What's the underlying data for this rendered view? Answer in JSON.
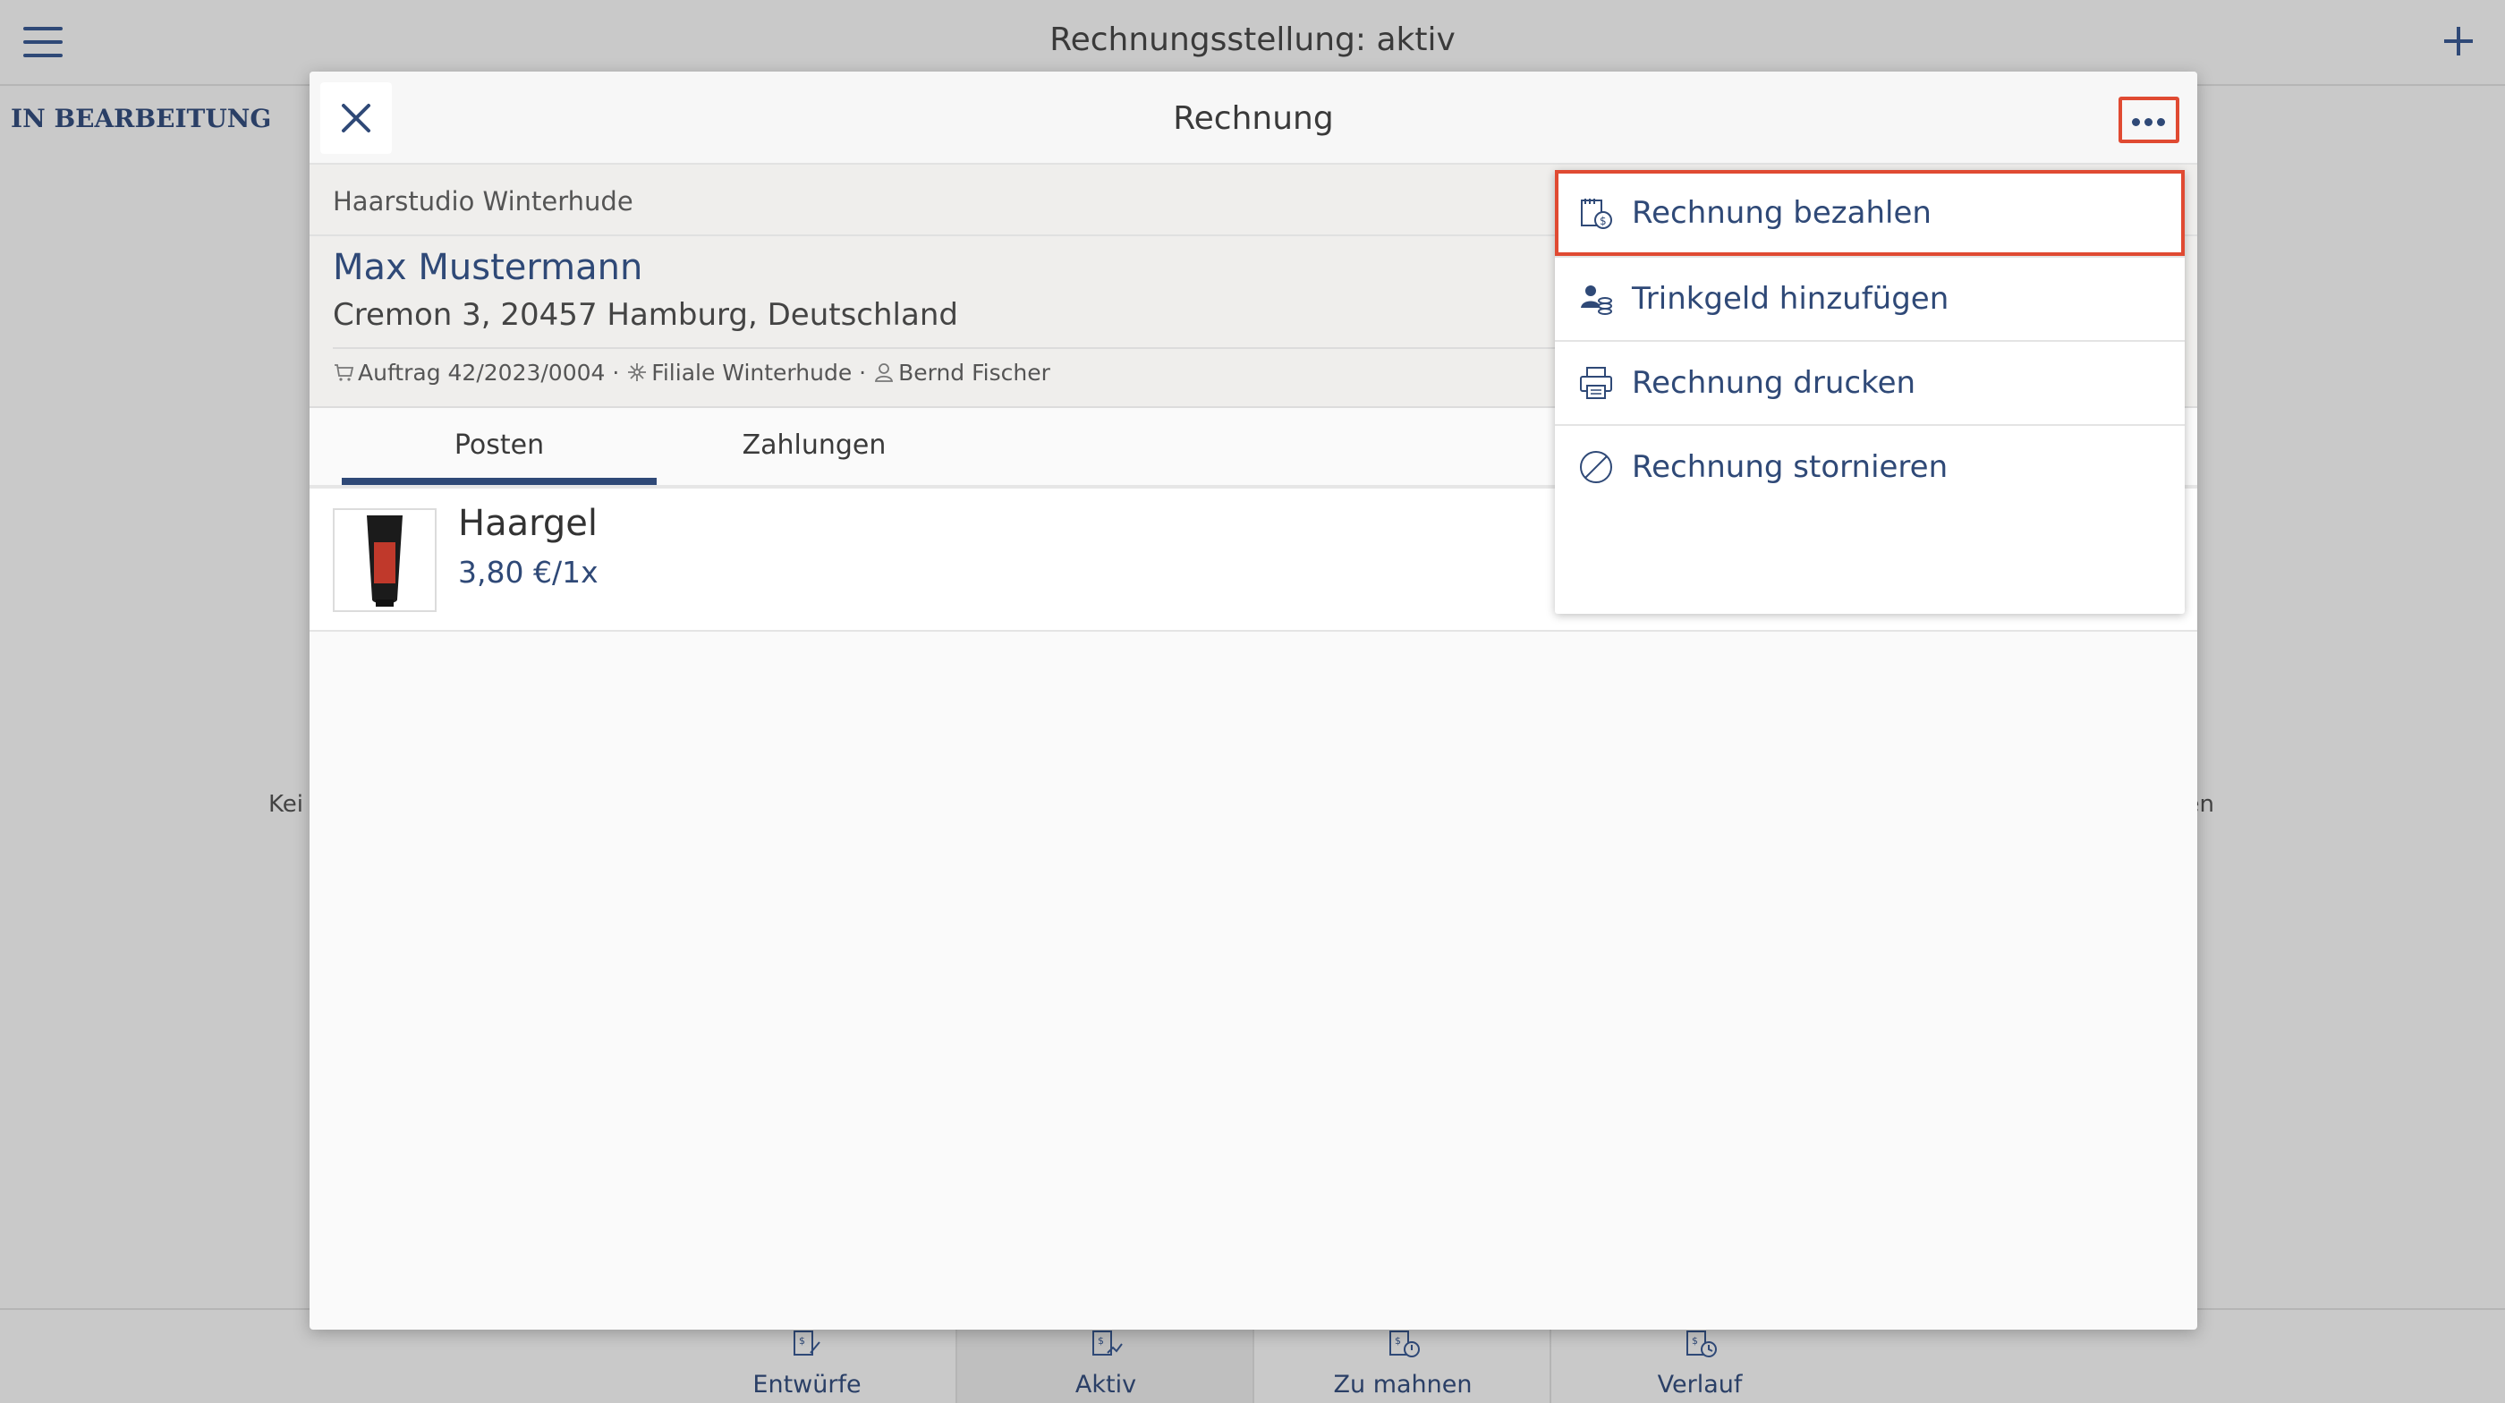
{
  "app": {
    "title": "Rechnungsstellung: aktiv",
    "section_label": "IN BEARBEITUNG",
    "empty_left": "Kei",
    "empty_right": "den"
  },
  "bottom_nav": [
    {
      "label": "Entwürfe",
      "icon": "invoice-draft-icon"
    },
    {
      "label": "Aktiv",
      "icon": "invoice-active-icon"
    },
    {
      "label": "Zu mahnen",
      "icon": "invoice-reminder-icon"
    },
    {
      "label": "Verlauf",
      "icon": "invoice-history-icon"
    }
  ],
  "modal": {
    "title": "Rechnung",
    "shop": "Haarstudio Winterhude",
    "customer_name": "Max Mustermann",
    "customer_address": "Cremon 3, 20457 Hamburg, Deutschland",
    "meta": {
      "order": "Auftrag 42/2023/0004",
      "sep": "·",
      "branch": "Filiale Winterhude",
      "employee": "Bernd Fischer"
    },
    "tabs": [
      {
        "label": "Posten",
        "active": true
      },
      {
        "label": "Zahlungen",
        "active": false
      }
    ],
    "items": [
      {
        "name": "Haargel",
        "price": "3,80 €/1x"
      }
    ]
  },
  "dropdown": {
    "items": [
      {
        "label": "Rechnung bezahlen",
        "icon": "pay-invoice-icon"
      },
      {
        "label": "Trinkgeld hinzufügen",
        "icon": "tip-icon"
      },
      {
        "label": "Rechnung drucken",
        "icon": "printer-icon"
      },
      {
        "label": "Rechnung stornieren",
        "icon": "cancel-invoice-icon"
      }
    ]
  },
  "colors": {
    "accent": "#2f4977",
    "highlight": "#e04a32",
    "overlay_background": "#c9c9c9"
  }
}
